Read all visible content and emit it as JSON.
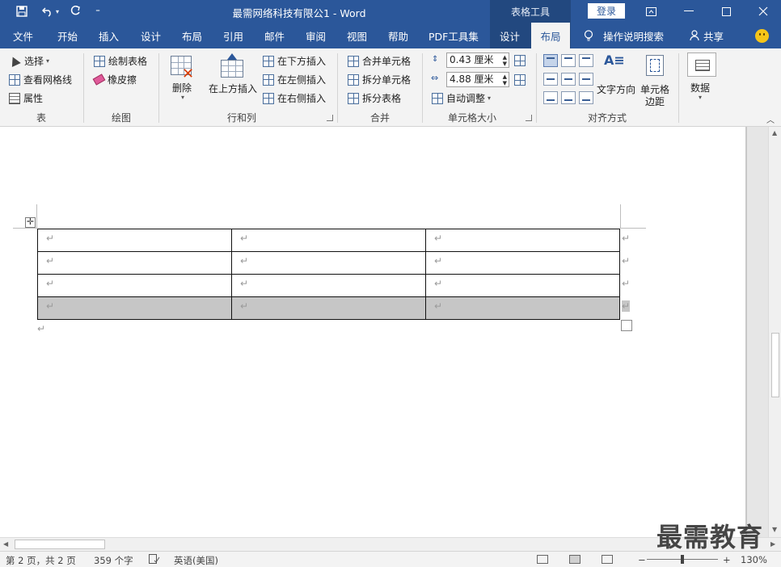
{
  "window": {
    "title": "最需网络科技有限公1  -  Word",
    "context_tab": "表格工具",
    "login": "登录"
  },
  "tabs": [
    {
      "label": "文件"
    },
    {
      "label": "开始"
    },
    {
      "label": "插入"
    },
    {
      "label": "设计"
    },
    {
      "label": "布局"
    },
    {
      "label": "引用"
    },
    {
      "label": "邮件"
    },
    {
      "label": "审阅"
    },
    {
      "label": "视图"
    },
    {
      "label": "帮助"
    },
    {
      "label": "PDF工具集"
    },
    {
      "label": "设计"
    },
    {
      "label": "布局"
    }
  ],
  "tell_me": "操作说明搜索",
  "share": "共享",
  "ribbon": {
    "table": {
      "select": "选择",
      "gridlines": "查看网格线",
      "properties": "属性",
      "label": "表"
    },
    "draw": {
      "draw_table": "绘制表格",
      "eraser": "橡皮擦",
      "label": "绘图"
    },
    "rows_cols": {
      "delete": "删除",
      "insert_above": "在上方插入",
      "insert_below": "在下方插入",
      "insert_left": "在左侧插入",
      "insert_right": "在右侧插入",
      "label": "行和列"
    },
    "merge": {
      "merge_cells": "合并单元格",
      "split_cells": "拆分单元格",
      "split_table": "拆分表格",
      "label": "合并"
    },
    "cell_size": {
      "height": "0.43 厘米",
      "width": "4.88 厘米",
      "autofit": "自动调整",
      "label": "单元格大小"
    },
    "alignment": {
      "text_direction": "文字方向",
      "cell_margins_1": "单元格",
      "cell_margins_2": "边距",
      "label": "对齐方式"
    },
    "data": {
      "label": "数据"
    }
  },
  "document": {
    "mark": "↵"
  },
  "status": {
    "page": "第 2 页，共 2 页",
    "words": "359 个字",
    "language": "英语(美国)",
    "zoom_minus": "−",
    "zoom_plus": "+",
    "zoom": "130%"
  },
  "watermark": "最需教育"
}
